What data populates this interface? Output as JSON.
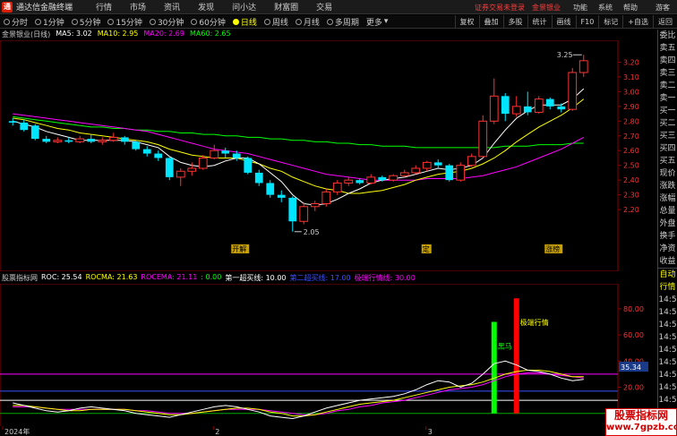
{
  "app": {
    "logo_glyph": "通",
    "title": "通达信金融终端",
    "menu": [
      "行情",
      "市场",
      "资讯",
      "发现",
      "问小达",
      "财富圈",
      "交易"
    ],
    "login_warning": "证券交易未登录",
    "broker": "金景银业",
    "functions": [
      "功能",
      "系统",
      "帮助"
    ],
    "guest": "游客"
  },
  "periods": [
    "分时",
    "1分钟",
    "5分钟",
    "15分钟",
    "30分钟",
    "60分钟",
    "日线",
    "周线",
    "月线",
    "多周期",
    "更多"
  ],
  "active_period": "日线",
  "tools": [
    "复权",
    "叠加",
    "多股",
    "统计",
    "画线",
    "F10",
    "标记",
    "+自选",
    "返回"
  ],
  "main_legend": {
    "name": "金景银业(日线)",
    "ma5": "MA5: 3.02",
    "ma10": "MA10: 2.95",
    "ma20": "MA20: 2.69",
    "ma60": "MA60: 2.65"
  },
  "colors": {
    "up": "#ff3232",
    "down": "#00e5ff",
    "ma5": "#ffffff",
    "ma10": "#ffff00",
    "ma20": "#ff00ff",
    "ma60": "#00ff00"
  },
  "price_axis": [
    "3.20",
    "3.10",
    "3.00",
    "2.90",
    "2.80",
    "2.70",
    "2.60",
    "2.50",
    "2.40",
    "2.30",
    "2.20"
  ],
  "annotations": {
    "high": "3.25",
    "low": "2.05",
    "mark1": "开解",
    "mark2": "定",
    "mark3": "涨榜"
  },
  "sub_legend": {
    "name": "股票指标网",
    "roc": "ROC: 25.54",
    "rocma": "ROCMA: 21.63",
    "rocema": "ROCEMA: 21.11",
    "v1": ": 0.00",
    "line1": "第一超买线: 10.00",
    "line2": "第二超买线: 17.00",
    "line3": "极端行情线: 30.00"
  },
  "sub_axis": [
    "80.00",
    "60.00",
    "40.00",
    "35.34",
    "20.00"
  ],
  "sub_labels": {
    "extreme": "极端行情",
    "horse": "黑马"
  },
  "date_axis": [
    "2024年",
    "2",
    "3"
  ],
  "rpanel": [
    "委比",
    "卖五",
    "卖四",
    "卖三",
    "卖二",
    "卖一",
    "买一",
    "买二",
    "买三",
    "买四",
    "买五",
    "现价",
    "涨跌",
    "涨幅",
    "总量",
    "外盘",
    "换手",
    "净资",
    "收益"
  ],
  "rpanel2": [
    "自动",
    "行情",
    "14:5",
    "14:5",
    "14:5",
    "14:5",
    "14:5",
    "14:5",
    "14:5",
    "14:5",
    "14:5",
    "14:5"
  ],
  "watermark": {
    "line1": "股票指标网",
    "line2": "www.7gpzb.com"
  },
  "chart_data": {
    "type": "candlestick",
    "ylim": [
      2.0,
      3.3
    ],
    "candles": [
      {
        "o": 2.8,
        "c": 2.79,
        "h": 2.82,
        "l": 2.77
      },
      {
        "o": 2.79,
        "c": 2.74,
        "h": 2.81,
        "l": 2.73
      },
      {
        "o": 2.77,
        "c": 2.68,
        "h": 2.78,
        "l": 2.67
      },
      {
        "o": 2.68,
        "c": 2.66,
        "h": 2.7,
        "l": 2.65
      },
      {
        "o": 2.66,
        "c": 2.67,
        "h": 2.69,
        "l": 2.65
      },
      {
        "o": 2.67,
        "c": 2.66,
        "h": 2.69,
        "l": 2.65
      },
      {
        "o": 2.66,
        "c": 2.68,
        "h": 2.7,
        "l": 2.65
      },
      {
        "o": 2.68,
        "c": 2.66,
        "h": 2.71,
        "l": 2.65
      },
      {
        "o": 2.66,
        "c": 2.67,
        "h": 2.69,
        "l": 2.64
      },
      {
        "o": 2.67,
        "c": 2.69,
        "h": 2.72,
        "l": 2.66
      },
      {
        "o": 2.69,
        "c": 2.66,
        "h": 2.7,
        "l": 2.64
      },
      {
        "o": 2.66,
        "c": 2.61,
        "h": 2.67,
        "l": 2.6
      },
      {
        "o": 2.61,
        "c": 2.58,
        "h": 2.63,
        "l": 2.56
      },
      {
        "o": 2.58,
        "c": 2.55,
        "h": 2.6,
        "l": 2.53
      },
      {
        "o": 2.55,
        "c": 2.42,
        "h": 2.56,
        "l": 2.4
      },
      {
        "o": 2.42,
        "c": 2.46,
        "h": 2.48,
        "l": 2.36
      },
      {
        "o": 2.46,
        "c": 2.48,
        "h": 2.52,
        "l": 2.43
      },
      {
        "o": 2.48,
        "c": 2.55,
        "h": 2.57,
        "l": 2.47
      },
      {
        "o": 2.55,
        "c": 2.6,
        "h": 2.64,
        "l": 2.54
      },
      {
        "o": 2.6,
        "c": 2.58,
        "h": 2.62,
        "l": 2.55
      },
      {
        "o": 2.58,
        "c": 2.55,
        "h": 2.6,
        "l": 2.53
      },
      {
        "o": 2.55,
        "c": 2.45,
        "h": 2.56,
        "l": 2.44
      },
      {
        "o": 2.45,
        "c": 2.38,
        "h": 2.47,
        "l": 2.36
      },
      {
        "o": 2.38,
        "c": 2.3,
        "h": 2.4,
        "l": 2.28
      },
      {
        "o": 2.3,
        "c": 2.28,
        "h": 2.33,
        "l": 2.25
      },
      {
        "o": 2.28,
        "c": 2.12,
        "h": 2.29,
        "l": 2.05
      },
      {
        "o": 2.12,
        "c": 2.22,
        "h": 2.25,
        "l": 2.1
      },
      {
        "o": 2.22,
        "c": 2.24,
        "h": 2.26,
        "l": 2.19
      },
      {
        "o": 2.24,
        "c": 2.32,
        "h": 2.34,
        "l": 2.22
      },
      {
        "o": 2.32,
        "c": 2.38,
        "h": 2.4,
        "l": 2.3
      },
      {
        "o": 2.38,
        "c": 2.4,
        "h": 2.42,
        "l": 2.36
      },
      {
        "o": 2.4,
        "c": 2.38,
        "h": 2.41,
        "l": 2.37
      },
      {
        "o": 2.38,
        "c": 2.42,
        "h": 2.44,
        "l": 2.37
      },
      {
        "o": 2.42,
        "c": 2.4,
        "h": 2.43,
        "l": 2.39
      },
      {
        "o": 2.4,
        "c": 2.43,
        "h": 2.44,
        "l": 2.39
      },
      {
        "o": 2.43,
        "c": 2.45,
        "h": 2.47,
        "l": 2.42
      },
      {
        "o": 2.45,
        "c": 2.48,
        "h": 2.5,
        "l": 2.44
      },
      {
        "o": 2.48,
        "c": 2.52,
        "h": 2.53,
        "l": 2.46
      },
      {
        "o": 2.52,
        "c": 2.5,
        "h": 2.54,
        "l": 2.48
      },
      {
        "o": 2.5,
        "c": 2.4,
        "h": 2.51,
        "l": 2.39
      },
      {
        "o": 2.4,
        "c": 2.5,
        "h": 2.52,
        "l": 2.39
      },
      {
        "o": 2.5,
        "c": 2.56,
        "h": 2.58,
        "l": 2.49
      },
      {
        "o": 2.56,
        "c": 2.8,
        "h": 2.84,
        "l": 2.55
      },
      {
        "o": 2.8,
        "c": 2.97,
        "h": 3.09,
        "l": 2.78
      },
      {
        "o": 2.97,
        "c": 2.85,
        "h": 2.99,
        "l": 2.8
      },
      {
        "o": 2.85,
        "c": 2.9,
        "h": 2.97,
        "l": 2.83
      },
      {
        "o": 2.9,
        "c": 2.86,
        "h": 3.0,
        "l": 2.84
      },
      {
        "o": 2.86,
        "c": 2.95,
        "h": 2.97,
        "l": 2.85
      },
      {
        "o": 2.95,
        "c": 2.9,
        "h": 2.96,
        "l": 2.88
      },
      {
        "o": 2.9,
        "c": 2.88,
        "h": 2.92,
        "l": 2.86
      },
      {
        "o": 2.88,
        "c": 3.13,
        "h": 3.16,
        "l": 2.87
      },
      {
        "o": 3.13,
        "c": 3.21,
        "h": 3.25,
        "l": 3.1
      }
    ],
    "ma5": [
      2.8,
      2.78,
      2.76,
      2.73,
      2.71,
      2.69,
      2.67,
      2.67,
      2.67,
      2.67,
      2.67,
      2.66,
      2.64,
      2.62,
      2.56,
      2.52,
      2.5,
      2.49,
      2.5,
      2.53,
      2.55,
      2.55,
      2.51,
      2.45,
      2.39,
      2.3,
      2.24,
      2.23,
      2.24,
      2.27,
      2.31,
      2.34,
      2.38,
      2.4,
      2.41,
      2.42,
      2.44,
      2.46,
      2.48,
      2.47,
      2.48,
      2.5,
      2.55,
      2.65,
      2.74,
      2.82,
      2.87,
      2.91,
      2.91,
      2.91,
      2.95,
      3.02
    ],
    "ma10": [
      2.82,
      2.81,
      2.79,
      2.77,
      2.75,
      2.74,
      2.72,
      2.71,
      2.7,
      2.69,
      2.68,
      2.67,
      2.66,
      2.64,
      2.61,
      2.59,
      2.57,
      2.56,
      2.55,
      2.55,
      2.55,
      2.53,
      2.51,
      2.48,
      2.46,
      2.42,
      2.39,
      2.36,
      2.34,
      2.33,
      2.31,
      2.31,
      2.32,
      2.33,
      2.35,
      2.37,
      2.4,
      2.42,
      2.44,
      2.45,
      2.46,
      2.48,
      2.51,
      2.55,
      2.6,
      2.66,
      2.71,
      2.76,
      2.8,
      2.84,
      2.89,
      2.95
    ],
    "ma20": [
      2.85,
      2.84,
      2.83,
      2.82,
      2.81,
      2.8,
      2.79,
      2.78,
      2.77,
      2.76,
      2.75,
      2.74,
      2.73,
      2.71,
      2.69,
      2.67,
      2.65,
      2.63,
      2.61,
      2.6,
      2.59,
      2.58,
      2.56,
      2.54,
      2.52,
      2.5,
      2.48,
      2.46,
      2.44,
      2.43,
      2.42,
      2.41,
      2.4,
      2.4,
      2.4,
      2.4,
      2.4,
      2.41,
      2.41,
      2.41,
      2.41,
      2.42,
      2.43,
      2.45,
      2.47,
      2.49,
      2.52,
      2.55,
      2.58,
      2.61,
      2.65,
      2.69
    ],
    "ma60": [
      2.83,
      2.82,
      2.81,
      2.8,
      2.79,
      2.78,
      2.77,
      2.76,
      2.76,
      2.75,
      2.75,
      2.74,
      2.74,
      2.73,
      2.73,
      2.72,
      2.72,
      2.71,
      2.71,
      2.7,
      2.7,
      2.69,
      2.69,
      2.68,
      2.68,
      2.67,
      2.67,
      2.66,
      2.66,
      2.65,
      2.65,
      2.64,
      2.64,
      2.63,
      2.63,
      2.63,
      2.62,
      2.62,
      2.62,
      2.62,
      2.62,
      2.62,
      2.62,
      2.62,
      2.63,
      2.63,
      2.63,
      2.64,
      2.64,
      2.64,
      2.65,
      2.65
    ],
    "sub": {
      "ylim": [
        -5,
        95
      ],
      "roc": [
        8,
        6,
        4,
        2,
        1,
        2,
        4,
        5,
        4,
        3,
        2,
        0,
        -1,
        -2,
        -3,
        -1,
        1,
        3,
        5,
        6,
        5,
        3,
        1,
        -2,
        -3,
        -4,
        -2,
        1,
        4,
        6,
        8,
        10,
        11,
        12,
        13,
        15,
        18,
        22,
        25,
        24,
        20,
        23,
        30,
        38,
        40,
        37,
        33,
        32,
        30,
        27,
        25,
        26
      ],
      "rocma": [
        6,
        6,
        5,
        4,
        3,
        2,
        2,
        3,
        3,
        3,
        3,
        2,
        1,
        0,
        -1,
        -1,
        0,
        1,
        2,
        3,
        4,
        4,
        3,
        1,
        0,
        -2,
        -2,
        -1,
        1,
        3,
        5,
        7,
        8,
        9,
        10,
        12,
        14,
        16,
        18,
        20,
        21,
        22,
        24,
        27,
        30,
        32,
        33,
        33,
        32,
        30,
        28,
        28
      ],
      "rocema": [
        5,
        5,
        5,
        4,
        3,
        3,
        3,
        3,
        3,
        3,
        3,
        2,
        2,
        1,
        0,
        0,
        0,
        1,
        2,
        3,
        3,
        3,
        3,
        2,
        1,
        0,
        -1,
        -1,
        0,
        2,
        3,
        5,
        6,
        8,
        9,
        10,
        12,
        14,
        16,
        18,
        19,
        20,
        22,
        25,
        28,
        30,
        31,
        31,
        30,
        29,
        28,
        27
      ],
      "lines": [
        10,
        17,
        30
      ],
      "bars": [
        {
          "i": 43,
          "value": 70,
          "color": "#00ff00",
          "label": "horse"
        },
        {
          "i": 45,
          "value": 88,
          "color": "#ff0000",
          "label": "extreme"
        }
      ]
    }
  }
}
